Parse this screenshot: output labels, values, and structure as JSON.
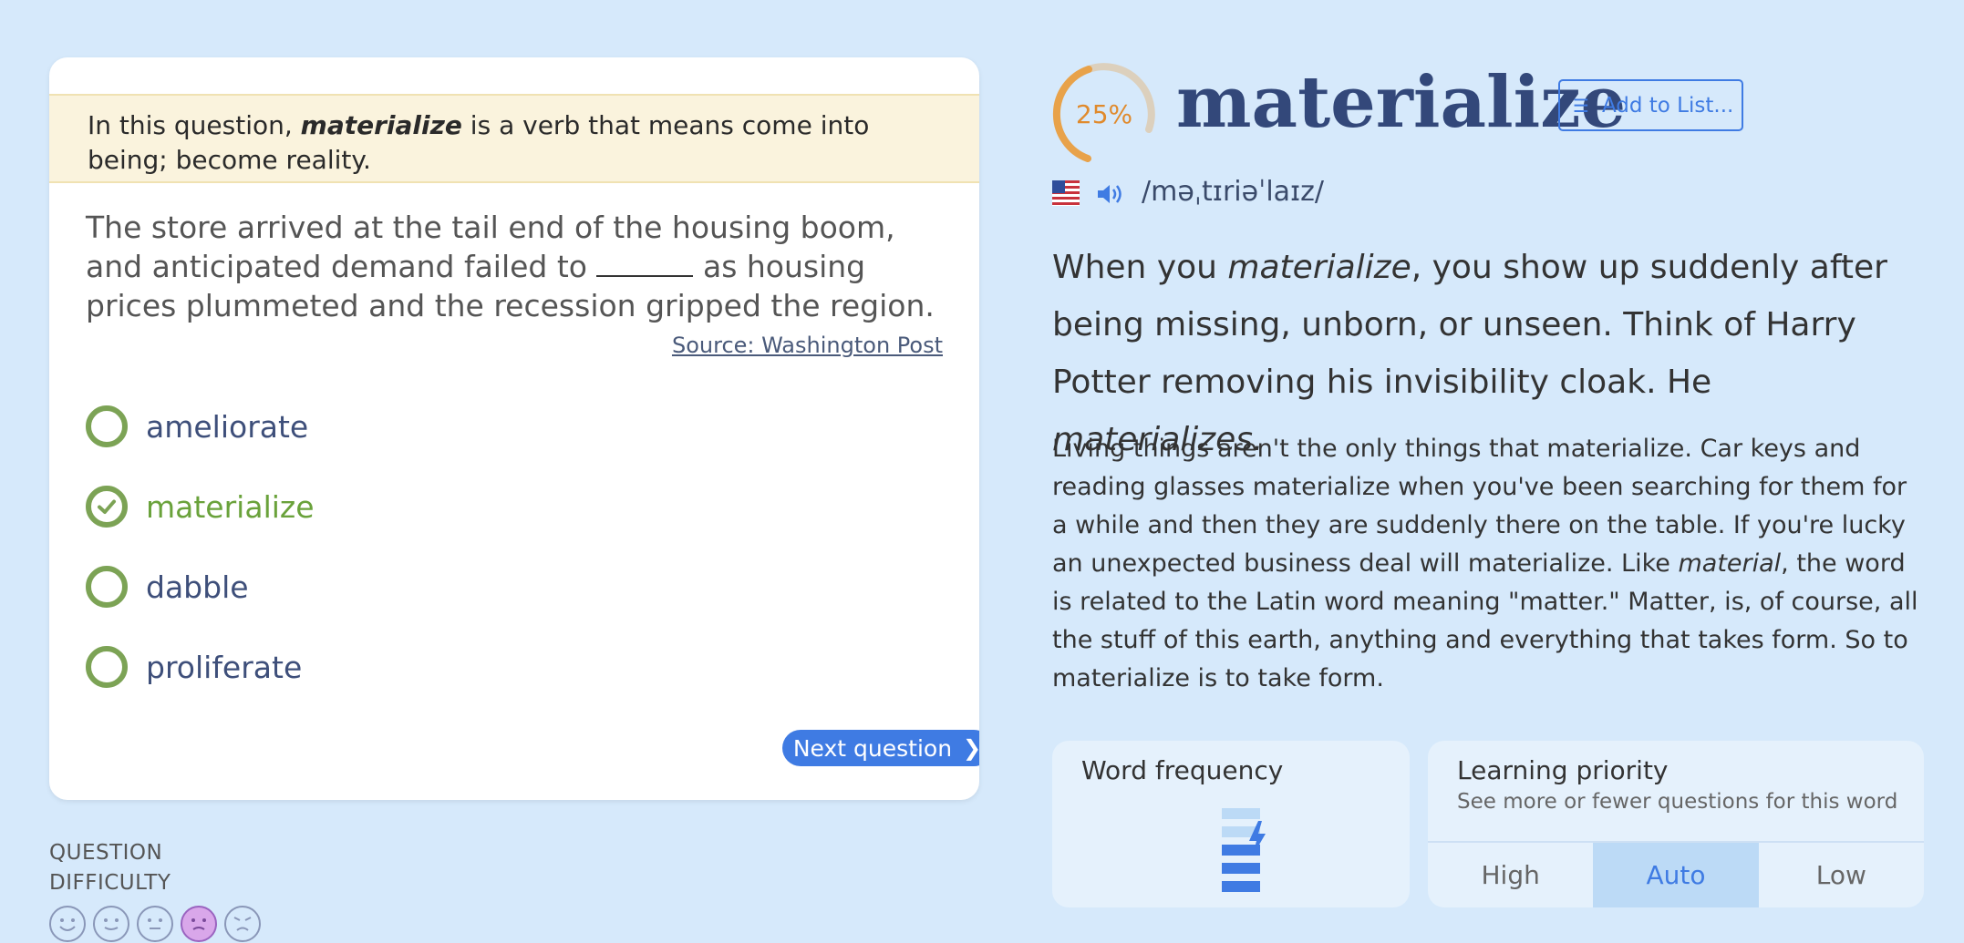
{
  "question": {
    "hint_prefix": "In this question, ",
    "hint_word": "materialize",
    "hint_suffix": " is a verb that means come into being; become reality.",
    "sentence_before": "The store arrived at the tail end of the housing boom, and anticipated demand failed to ",
    "sentence_after": " as housing prices plummeted and the recession gripped the region.",
    "source": "Source: Washington Post",
    "choices": [
      {
        "label": "ameliorate",
        "correct": false
      },
      {
        "label": "materialize",
        "correct": true
      },
      {
        "label": "dabble",
        "correct": false
      },
      {
        "label": "proliferate",
        "correct": false
      }
    ],
    "next_label": "Next question",
    "next_icon": "❯"
  },
  "difficulty": {
    "line1": "QUESTION",
    "line2": "DIFFICULTY",
    "faces": [
      "very-happy-face-icon",
      "happy-face-icon",
      "neutral-face-icon",
      "sad-face-icon",
      "angry-face-icon"
    ],
    "selected_index": 3
  },
  "word": {
    "progress_label": "25%",
    "progress_value": 0.25,
    "title": "materialize",
    "add_to_list": "Add to List...",
    "pronunciation": "/məˌtɪriəˈlaɪz/",
    "short_def_1": "When you ",
    "short_def_word": "materialize",
    "short_def_2": ", you show up suddenly after being missing, unborn, or unseen. Think of Harry Potter removing his invisibility cloak. He ",
    "short_def_word2": "materializes.",
    "long_def_1": "Living things aren't the only things that materialize. Car keys and reading glasses materialize when you've been searching for them for a while and then they are suddenly there on the table. If you're lucky an unexpected business deal will materialize. Like ",
    "long_def_word": "material",
    "long_def_2": ", the word is related to the Latin word meaning \"matter.\" Matter, is, of course, all the stuff of this earth, anything and everything that takes form. So to materialize is to take form."
  },
  "frequency": {
    "title": "Word frequency"
  },
  "priority": {
    "title": "Learning priority",
    "subtitle": "See more or fewer questions for this word",
    "options": [
      "High",
      "Auto",
      "Low"
    ],
    "selected": "Auto"
  },
  "colors": {
    "accent": "#3f7be3",
    "correct": "#6aa23b",
    "progress": "#e8a24a",
    "background": "#d6e9fb"
  }
}
